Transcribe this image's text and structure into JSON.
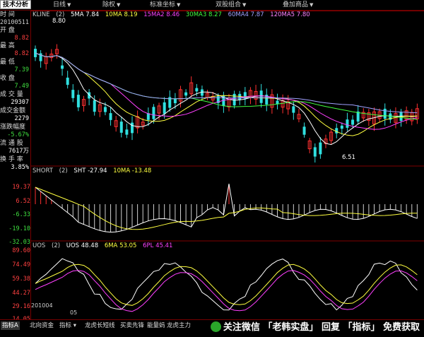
{
  "menubar": {
    "tech_button": "技术分析",
    "items": [
      {
        "label": "日线"
      },
      {
        "label": "除权"
      },
      {
        "label": "标准坐标"
      },
      {
        "label": "双股组合"
      },
      {
        "label": "叠加商品"
      }
    ]
  },
  "sidebar": {
    "time_label": "时 间",
    "date_value": "20100511",
    "fields": [
      {
        "label": "开  盘",
        "value": "8.82",
        "color": "#ff4040"
      },
      {
        "label": "最  高",
        "value": "8.82",
        "color": "#ff4040"
      },
      {
        "label": "最  低",
        "value": "7.39",
        "color": "#40e040"
      },
      {
        "label": "收  盘",
        "value": "7.49",
        "color": "#40e040"
      },
      {
        "label": "成 交 量",
        "value": "29307",
        "color": "#ffffff"
      },
      {
        "label": "成交金额",
        "value": "2279",
        "color": "#ffffff"
      },
      {
        "label": "涨跌幅度",
        "value": "-5.67%",
        "color": "#40e040"
      },
      {
        "label": "流 通 股",
        "value": "7617万",
        "color": "#ffffff"
      },
      {
        "label": "换 手 率",
        "value": "3.85%",
        "color": "#ffffff"
      }
    ]
  },
  "price_pane": {
    "header": {
      "name": "KLINE",
      "param": "(2)",
      "ma": [
        {
          "label": "5MA 7.84",
          "color": "#ffffff"
        },
        {
          "label": "10MA 8.19",
          "color": "#ffff40"
        },
        {
          "label": "15MA2 8.46",
          "color": "#ff40ff"
        },
        {
          "label": "30MA3 8.27",
          "color": "#40ff40"
        },
        {
          "label": "60MA4 7.87",
          "color": "#a0a0ff"
        },
        {
          "label": "120MA5 7.80",
          "color": "#ff80ff"
        }
      ]
    },
    "high_label": "8.80",
    "low_label": "6.51"
  },
  "sht_pane": {
    "header": {
      "name": "SHORT",
      "param": "(2)",
      "values": [
        {
          "label": "SHT -27.94",
          "color": "#ffffff"
        },
        {
          "label": "10MA -13.48",
          "color": "#ffff40"
        }
      ]
    },
    "ylabels": [
      {
        "value": "19.37",
        "color": "#ff4040"
      },
      {
        "value": "6.52",
        "color": "#ff4040"
      },
      {
        "value": "-6.33",
        "color": "#40e040"
      },
      {
        "value": "-19.10",
        "color": "#40e040"
      },
      {
        "value": "-32.03",
        "color": "#40e040"
      }
    ]
  },
  "uos_pane": {
    "header": {
      "name": "UOS",
      "param": "(2)",
      "values": [
        {
          "label": "UOS 48.48",
          "color": "#ffffff"
        },
        {
          "label": "6MA 53.05",
          "color": "#ffff40"
        },
        {
          "label": "6PL 45.41",
          "color": "#ff40ff"
        }
      ]
    },
    "ylabels": [
      {
        "value": "89.60",
        "color": "#ff4040"
      },
      {
        "value": "74.49",
        "color": "#ff4040"
      },
      {
        "value": "59.38",
        "color": "#ff4040"
      },
      {
        "value": "44.27",
        "color": "#ff4040"
      },
      {
        "value": "29.16",
        "color": "#ff4040"
      },
      {
        "value": "14.05",
        "color": "#ff4040"
      }
    ],
    "x_labels": [
      "201004",
      "05"
    ]
  },
  "bottom_tabs": [
    {
      "label": "指标A",
      "active": true
    },
    {
      "label": "北向资金",
      "active": false
    },
    {
      "label": "指标 ▾",
      "active": false
    },
    {
      "label": "龙虎长短线",
      "active": false
    },
    {
      "label": "买卖先锋",
      "active": false
    },
    {
      "label": "能量蚂",
      "active": false
    },
    {
      "label": "龙虎主力",
      "active": false
    }
  ],
  "watermark": "关注微信 「老韩实盘」 回复 「指标」 免费获取"
}
